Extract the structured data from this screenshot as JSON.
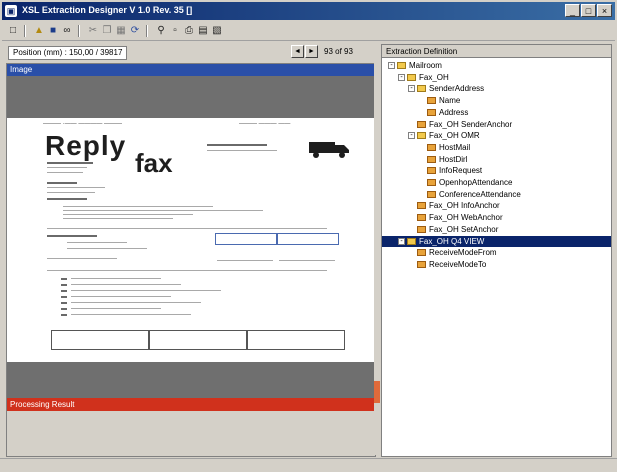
{
  "window": {
    "title": "XSL Extraction Designer V 1.0 Rev. 35 []",
    "buttons": [
      "_",
      "□",
      "×"
    ]
  },
  "toolbar": {
    "icons": [
      "new-icon",
      "open-icon",
      "save-icon",
      "link-icon",
      "cut-icon",
      "copy-icon",
      "paste-icon",
      "rotate-icon",
      "zoom-icon",
      "page-setup-icon",
      "print-icon",
      "properties-icon",
      "help-icon"
    ]
  },
  "position_bar": {
    "label": "Position (mm) : 150,00 / 39817",
    "prev": "◄",
    "next": "►",
    "page_count": "93 of 93"
  },
  "left_panel": {
    "header": "Image",
    "result_label": "Processing Result"
  },
  "document": {
    "reply": "Reply",
    "fax": "fax"
  },
  "right_panel": {
    "header": "Extraction Definition",
    "tree": [
      {
        "label": "Mailroom",
        "level": 0,
        "expander": "-"
      },
      {
        "label": "Fax_OH",
        "level": 1,
        "expander": "-"
      },
      {
        "label": "SenderAddress",
        "level": 2,
        "expander": "-"
      },
      {
        "label": "Name",
        "level": 3,
        "expander": ""
      },
      {
        "label": "Address",
        "level": 3,
        "expander": ""
      },
      {
        "label": "Fax_OH SenderAnchor",
        "level": 2,
        "expander": ""
      },
      {
        "label": "Fax_OH OMR",
        "level": 2,
        "expander": "-"
      },
      {
        "label": "HostMail",
        "level": 3,
        "expander": ""
      },
      {
        "label": "HostDirl",
        "level": 3,
        "expander": ""
      },
      {
        "label": "InfoRequest",
        "level": 3,
        "expander": ""
      },
      {
        "label": "OpenhopAttendance",
        "level": 3,
        "expander": ""
      },
      {
        "label": "ConferenceAttendance",
        "level": 3,
        "expander": ""
      },
      {
        "label": "Fax_OH InfoAnchor",
        "level": 2,
        "expander": ""
      },
      {
        "label": "Fax_OH WebAnchor",
        "level": 2,
        "expander": ""
      },
      {
        "label": "Fax_OH SetAnchor",
        "level": 2,
        "expander": ""
      },
      {
        "label": "Fax_OH Q4 VIEW",
        "level": 1,
        "expander": "-",
        "selected": true
      },
      {
        "label": "ReceiveModeFrom",
        "level": 2,
        "expander": ""
      },
      {
        "label": "ReceiveModeTo",
        "level": 2,
        "expander": ""
      }
    ]
  },
  "colors": {
    "titlebar": "#0a246a",
    "image_header": "#2a4fa8",
    "result_bar": "#d0311c",
    "selection": "#0a246a"
  }
}
